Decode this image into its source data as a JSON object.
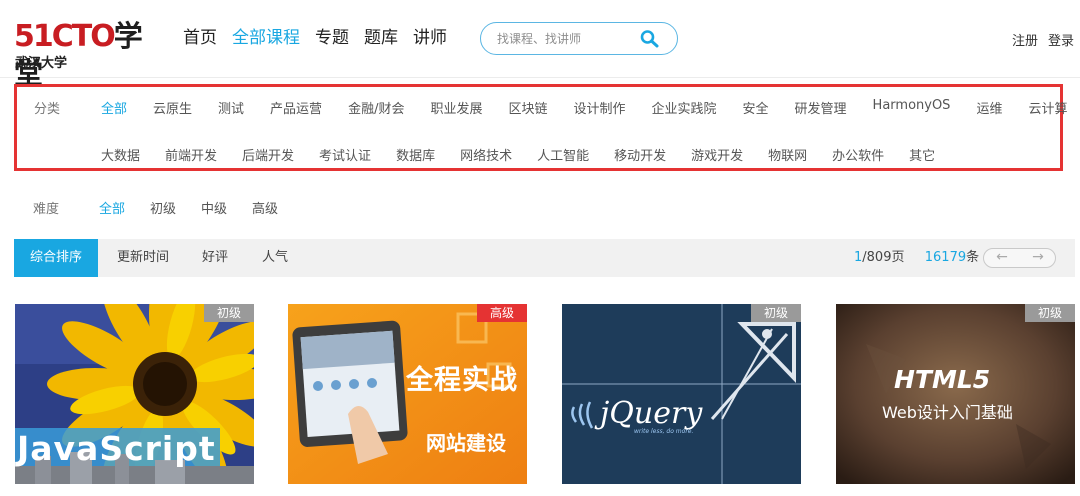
{
  "header": {
    "logo_main": "51CTO",
    "logo_xt": "学堂",
    "logo_sub": "武汉大学",
    "nav": [
      "首页",
      "全部课程",
      "专题",
      "题库",
      "讲师"
    ],
    "nav_active": 1,
    "search_placeholder": "找课程、找讲师",
    "register": "注册",
    "login": "登录"
  },
  "category": {
    "label": "分类",
    "row1": [
      "全部",
      "云原生",
      "测试",
      "产品运营",
      "金融/财会",
      "职业发展",
      "区块链",
      "设计制作",
      "企业实践院",
      "安全",
      "研发管理",
      "HarmonyOS",
      "运维",
      "云计算"
    ],
    "row2": [
      "大数据",
      "前端开发",
      "后端开发",
      "考试认证",
      "数据库",
      "网络技术",
      "人工智能",
      "移动开发",
      "游戏开发",
      "物联网",
      "办公软件",
      "其它"
    ],
    "active": "全部"
  },
  "difficulty": {
    "label": "难度",
    "items": [
      "全部",
      "初级",
      "中级",
      "高级"
    ],
    "active": "全部"
  },
  "sort": {
    "items": [
      "综合排序",
      "更新时间",
      "好评",
      "人气"
    ],
    "active": "综合排序",
    "page_current": "1",
    "page_total": "/809页",
    "count": "16179",
    "count_unit": "条",
    "prev_arrow": "←",
    "next_arrow": "→"
  },
  "courses": [
    {
      "badge": "初级",
      "badge_color": "#9a9a9a",
      "image_text": "JavaScript"
    },
    {
      "badge": "高级",
      "badge_color": "#e53333",
      "image_text": "全程实战",
      "image_text2": "网站建设"
    },
    {
      "badge": "初级",
      "badge_color": "#9a9a9a",
      "image_text": "jQuery",
      "image_text2": "write less, do more."
    },
    {
      "badge": "初级",
      "badge_color": "#9a9a9a",
      "image_text": "HTML5",
      "image_text2": "Web设计入门基础"
    }
  ],
  "colors": {
    "accent": "#19a7e1",
    "brand_red": "#c81d22",
    "highlight": "#e53333"
  }
}
